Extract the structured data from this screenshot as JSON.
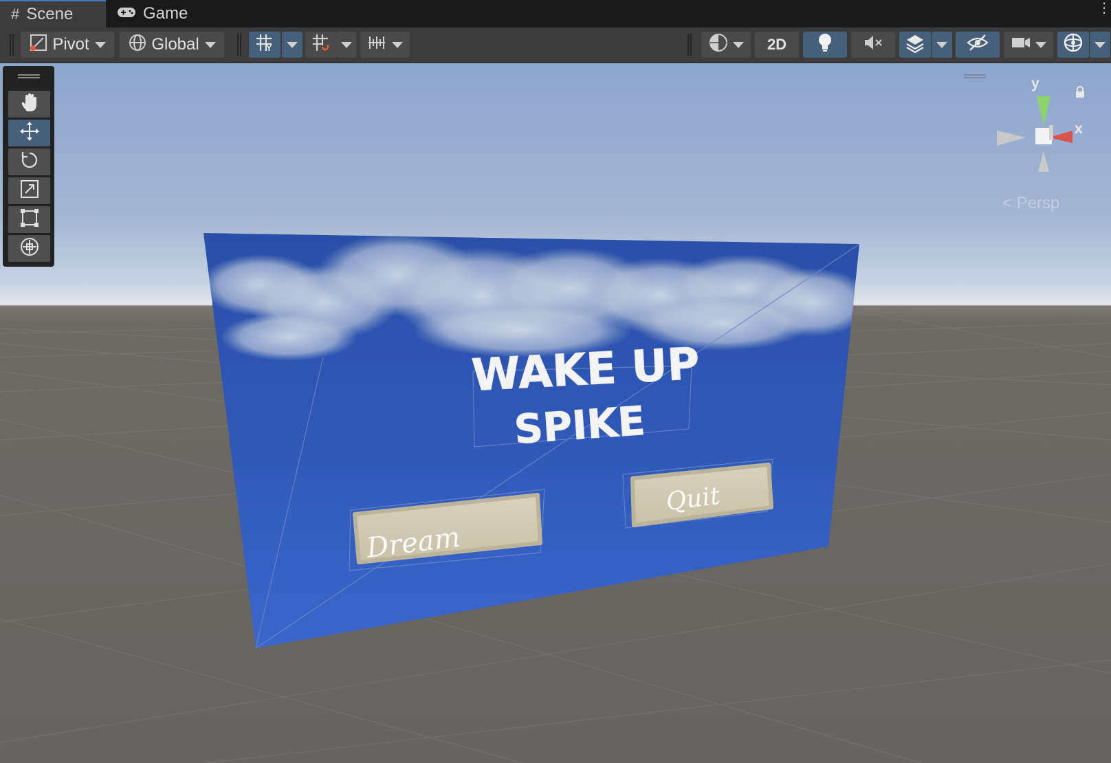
{
  "tabs": [
    {
      "label": "Scene",
      "icon": "grid-hash-icon",
      "active": true
    },
    {
      "label": "Game",
      "icon": "gamepad-icon",
      "active": false
    }
  ],
  "toolbar": {
    "pivot_label": "Pivot",
    "global_label": "Global",
    "mode_2d_label": "2D"
  },
  "tools": [
    "hand-tool",
    "move-tool",
    "rotate-tool",
    "scale-tool",
    "rect-tool",
    "transform-tool"
  ],
  "active_tool": "move-tool",
  "gizmo": {
    "y_label": "y",
    "x_label": "x",
    "projection_label": "Persp"
  },
  "scene_content": {
    "title_line1": "WAKE UP",
    "title_line2": "SPIKE",
    "button_dream": "Dream",
    "button_quit": "Quit"
  },
  "colors": {
    "active_button": "#46607c",
    "tab_accent": "#3a79bb",
    "canvas_blue": "#2f58b7",
    "ground": "#6b6763",
    "axis_x": "#d9534f",
    "axis_y": "#8cd46a"
  }
}
